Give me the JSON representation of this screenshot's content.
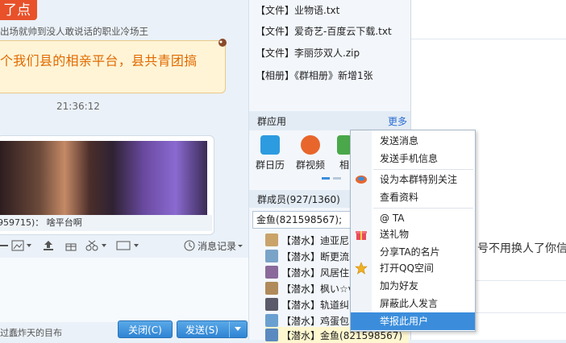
{
  "chat": {
    "title_tag": "了点",
    "sender_line": "出场就帅到没人敢说话的职业冷场王",
    "bubble_text": "个我们县的相亲平台，县共青团搞",
    "time": "21:36:12",
    "image_caption": "959715)： 啥平台啊",
    "toolbar": {
      "history_label": "消息记录"
    },
    "bottom_note": "过蠢炸天的目布",
    "close_label": "关闭(C)",
    "send_label": "发送(S)"
  },
  "side": {
    "files": [
      "【文件】业物语.txt",
      "【文件】爱奇艺-百度云下载.txt",
      "【文件】李丽莎双人.zip",
      "【相册】《群相册》新增1张"
    ],
    "apps_title": "群应用",
    "apps_more": "更多",
    "apps": [
      {
        "label": "群日历",
        "icon": "calendar-icon",
        "color": "#2d9be0"
      },
      {
        "label": "群视频",
        "icon": "video-icon",
        "color": "#e8662c"
      },
      {
        "label": "相",
        "icon": "album-icon",
        "color": "#4aa84a"
      }
    ],
    "members_title": "群成员(927/1360)",
    "member_search_value": "金鱼(821598567);",
    "members": [
      {
        "tag": "【潜水】",
        "name": "迪亚尼"
      },
      {
        "tag": "【潜水】",
        "name": "断更流"
      },
      {
        "tag": "【潜水】",
        "name": "风居住"
      },
      {
        "tag": "【潜水】",
        "name": "枫い☆v"
      },
      {
        "tag": "【潜水】",
        "name": "轨道纠"
      },
      {
        "tag": "【潜水】",
        "name": "鸡蛋包"
      },
      {
        "tag": "【潜水】",
        "name": "金鱼(821598567)"
      }
    ]
  },
  "right": {
    "text": "号不用换人了你信"
  },
  "menu": {
    "items": [
      "发送消息",
      "发送手机信息",
      "设为本群特别关注",
      "查看资料",
      "@ TA",
      "送礼物",
      "分享TA的名片",
      "打开QQ空间",
      "加为好友",
      "屏蔽此人发言",
      "举报此用户"
    ]
  },
  "colors": {
    "accent": "#3b8ddc",
    "title_tag": "#e8512a",
    "bubble_text": "#e06a00"
  }
}
